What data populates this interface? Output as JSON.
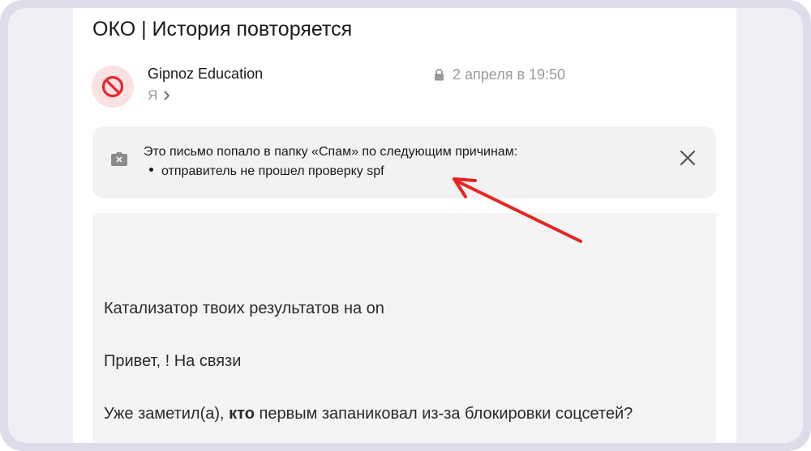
{
  "email": {
    "subject": "ОКО | История повторяется",
    "sender_name": "Gipnoz Education",
    "recipient": "Я",
    "date": "2 апреля в 19:50"
  },
  "spam_banner": {
    "message": "Это письмо попало в папку «Спам» по следующим причинам:",
    "reasons": [
      "отправитель не прошел проверку spf"
    ]
  },
  "body": {
    "line1": "Катализатор твоих результатов на on",
    "line2": "Привет, ! На связи",
    "line3_before": "Уже заметил(а), ",
    "line3_bold": "кто",
    "line3_after": " первым запаниковал из-за блокировки соцсетей?"
  },
  "colors": {
    "annotation_arrow": "#e8231f",
    "avatar_bg": "#fbe1e1",
    "avatar_icon": "#e5282c",
    "frame": "#dcdcea"
  },
  "icons": {
    "avatar": "blocked-sender-icon",
    "date": "lock-icon",
    "spam": "spam-camera-icon",
    "close": "close-icon",
    "recipient": "chevron-right-icon"
  }
}
